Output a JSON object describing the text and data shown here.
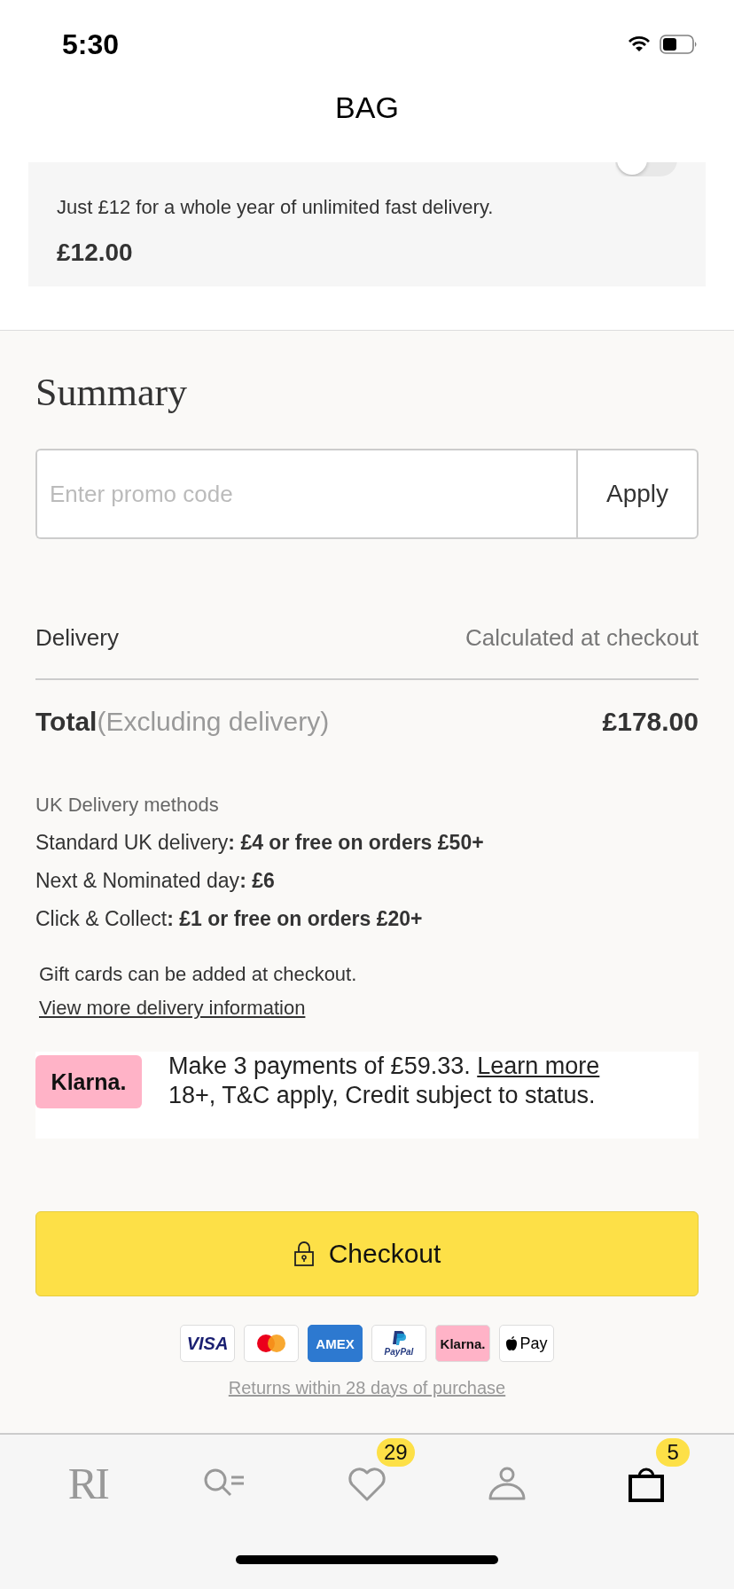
{
  "status_bar": {
    "time": "5:30"
  },
  "header": {
    "title": "BAG"
  },
  "delivery_offer": {
    "on": false,
    "description": "Just £12 for a whole year of unlimited fast delivery.",
    "price": "£12.00"
  },
  "summary": {
    "title": "Summary",
    "promo": {
      "placeholder": "Enter promo code",
      "button": "Apply"
    },
    "delivery": {
      "label": "Delivery",
      "value": "Calculated at checkout"
    },
    "total": {
      "label": "Total",
      "note": "(Excluding delivery)",
      "value": "£178.00"
    },
    "methods_title": "UK Delivery methods",
    "methods": [
      "Standard UK delivery**: £4 or free on orders £50+**",
      "Next & Nominated day**: £6**",
      "Click & Collect**: £1 or free on orders £20+**"
    ],
    "gift_note": "Gift cards can be added at checkout.",
    "delivery_link": "View more delivery information",
    "klarna": {
      "logo": "Klarna.",
      "text": "Make 3 payments of £59.33.",
      "link": "Learn more",
      "terms": "18+, T&C apply, Credit subject to status."
    },
    "checkout": "Checkout",
    "payments": [
      {
        "kind": "visa",
        "label": "VISA"
      },
      {
        "kind": "mastercard"
      },
      {
        "kind": "amex",
        "label": "AMEX"
      },
      {
        "kind": "paypal",
        "label": "PayPal"
      },
      {
        "kind": "klarna",
        "label": "Klarna."
      },
      {
        "kind": "applepay",
        "label": "Pay"
      }
    ],
    "returns": "Returns within 28 days of purchase"
  },
  "nav": [
    {
      "kind": "logo",
      "label": "RI",
      "selected": false
    },
    {
      "kind": "search",
      "selected": false
    },
    {
      "kind": "wishlist",
      "badge": "29",
      "selected": false
    },
    {
      "kind": "account",
      "selected": false
    },
    {
      "kind": "bag",
      "badge": "5",
      "selected": true
    }
  ]
}
